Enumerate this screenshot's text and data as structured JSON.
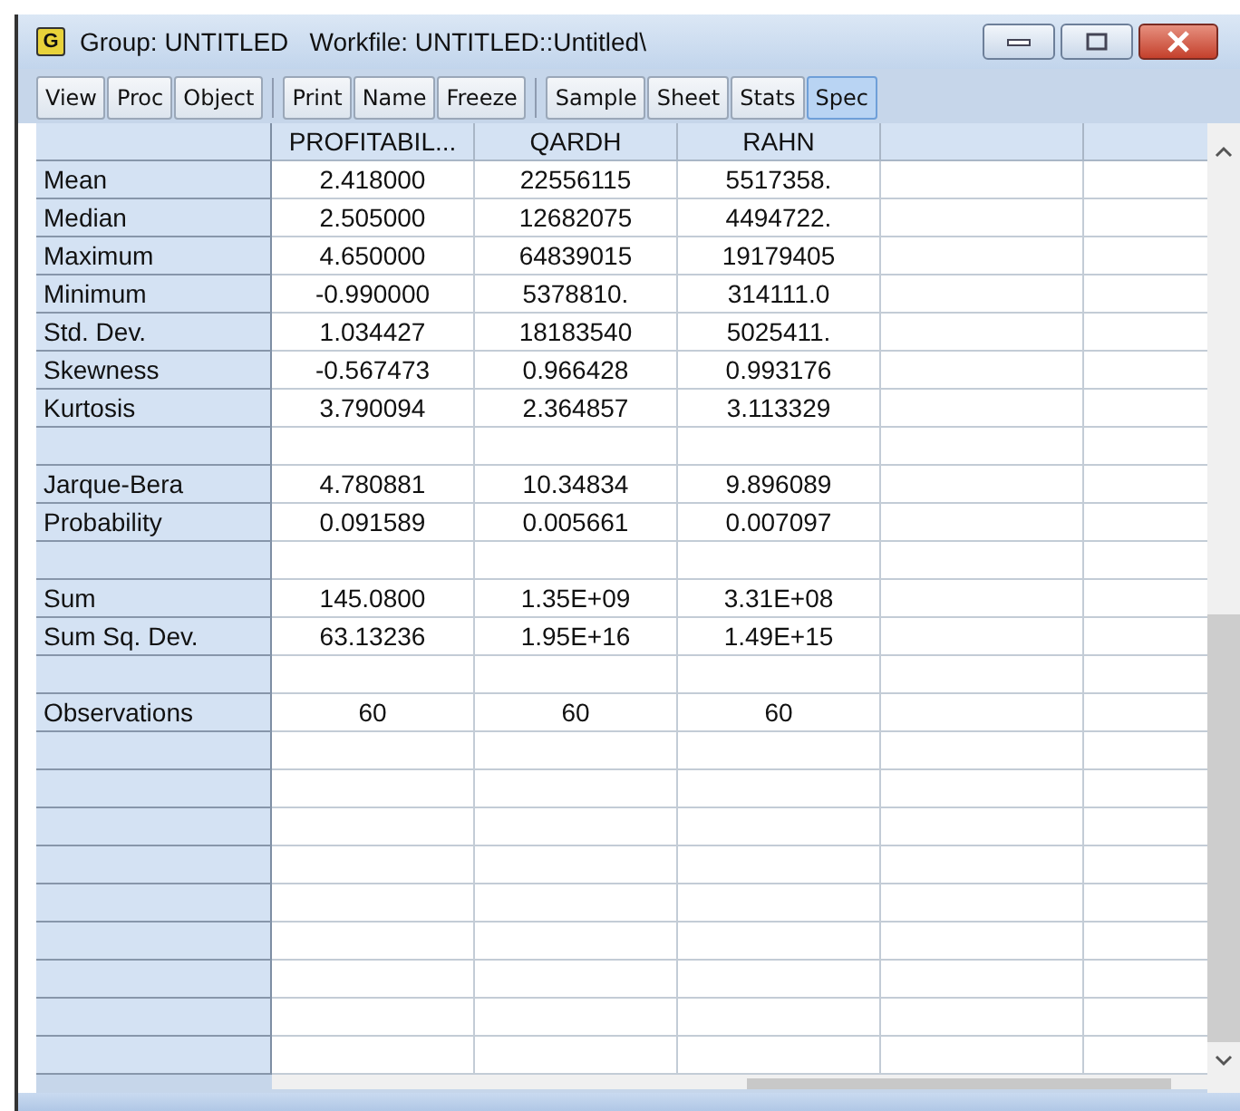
{
  "window": {
    "icon_letter": "G",
    "title": "Group: UNTITLED   Workfile: UNTITLED::Untitled\\"
  },
  "toolbar": [
    [
      {
        "label": "View",
        "selected": false
      },
      {
        "label": "Proc",
        "selected": false
      },
      {
        "label": "Object",
        "selected": false
      }
    ],
    [
      {
        "label": "Print",
        "selected": false
      },
      {
        "label": "Name",
        "selected": false
      },
      {
        "label": "Freeze",
        "selected": false
      }
    ],
    [
      {
        "label": "Sample",
        "selected": false
      },
      {
        "label": "Sheet",
        "selected": false
      },
      {
        "label": "Stats",
        "selected": false
      },
      {
        "label": "Spec",
        "selected": true
      }
    ]
  ],
  "table": {
    "columns": [
      "PROFITABIL...",
      "QARDH",
      "RAHN"
    ],
    "rows": [
      {
        "kind": "stat",
        "label": "Mean",
        "values": [
          "2.418000",
          "22556115",
          "5517358."
        ]
      },
      {
        "kind": "stat",
        "label": "Median",
        "values": [
          "2.505000",
          "12682075",
          "4494722."
        ]
      },
      {
        "kind": "stat",
        "label": "Maximum",
        "values": [
          "4.650000",
          "64839015",
          "19179405"
        ]
      },
      {
        "kind": "stat",
        "label": "Minimum",
        "values": [
          "-0.990000",
          "5378810.",
          "314111.0"
        ]
      },
      {
        "kind": "stat",
        "label": "Std. Dev.",
        "values": [
          "1.034427",
          "18183540",
          "5025411."
        ]
      },
      {
        "kind": "stat",
        "label": "Skewness",
        "values": [
          "-0.567473",
          "0.966428",
          "0.993176"
        ]
      },
      {
        "kind": "stat",
        "label": "Kurtosis",
        "values": [
          "3.790094",
          "2.364857",
          "3.113329"
        ]
      },
      {
        "kind": "blank"
      },
      {
        "kind": "stat",
        "label": "Jarque-Bera",
        "values": [
          "4.780881",
          "10.34834",
          "9.896089"
        ]
      },
      {
        "kind": "stat",
        "label": "Probability",
        "values": [
          "0.091589",
          "0.005661",
          "0.007097"
        ]
      },
      {
        "kind": "blank"
      },
      {
        "kind": "stat",
        "label": "Sum",
        "values": [
          "145.0800",
          "1.35E+09",
          "3.31E+08"
        ]
      },
      {
        "kind": "stat",
        "label": "Sum Sq. Dev.",
        "values": [
          "63.13236",
          "1.95E+16",
          "1.49E+15"
        ]
      },
      {
        "kind": "blank"
      },
      {
        "kind": "stat",
        "label": "Observations",
        "values": [
          "60",
          "60",
          "60"
        ]
      }
    ]
  }
}
